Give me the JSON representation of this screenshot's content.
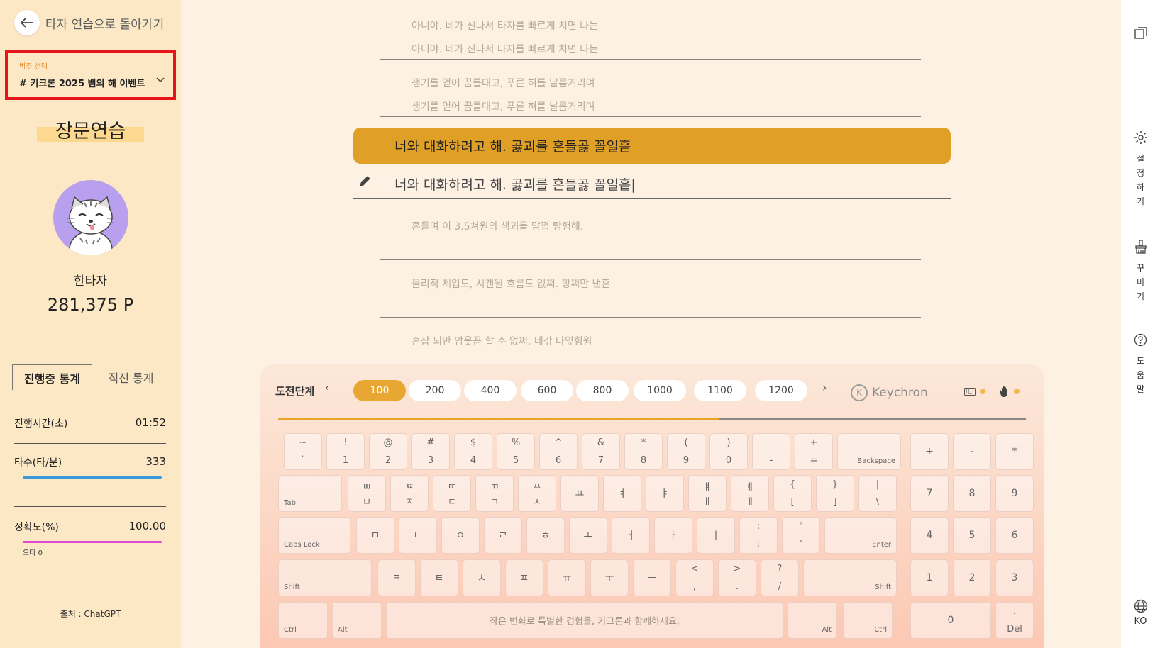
{
  "sidebar": {
    "back_label": "타자 연습으로 돌아가기",
    "category_label": "범주 선택",
    "category_value": "# 키크론 2025 뱀의 해 이벤트",
    "mode_title": "장문연습",
    "username": "한타자",
    "points": "281,375 P",
    "tabs": [
      "진행중 통계",
      "직전 통계"
    ],
    "stats": {
      "time_label": "진행시간(초)",
      "time_value": "01:52",
      "speed_label": "타수(타/분)",
      "speed_value": "333",
      "accuracy_label": "정확도(%)",
      "accuracy_value": "100.00",
      "typo_label": "오타 0"
    },
    "source": "출처 : ChatGPT",
    "colors": {
      "speed_bar": "#3a9ad9",
      "accuracy_bar": "#e24ad1"
    }
  },
  "passage": {
    "prev_lines": [
      {
        "text": "아니야. 네가 신나서 타자를 빠르게 치면 나는",
        "typed": "아니야. 네가 신나서 타자를 빠르게 치면 나는"
      },
      {
        "text": "생기를 얻어 꿈틀대고, 푸른 혀를 날름거리며",
        "typed": "생기를 얻어 꿈틀대고, 푸른 혀를 날름거리며"
      }
    ],
    "current_line": "너와 대화하려고 해. 곯괴를 흔들곯 꼴일흩",
    "current_input": "너와 대화하려고 해. 곯괴를 흔들곯 꼴일흩|",
    "next_lines": [
      "흔들며 이 3.5쳐원의 색괴를 맘껍 탐험해.",
      "물리적 제입도, 시갠윌 흐름도 없쩌. 항쩌만 낸흔",
      "혼잡 되만 암웃꼳 할 수 없쩌. 네갂 타잎힝윔"
    ]
  },
  "keyboard": {
    "challenge_label": "도전단계",
    "levels": [
      "100",
      "200",
      "400",
      "600",
      "800",
      "1000",
      "1100",
      "1200"
    ],
    "active_level": "100",
    "brand": "Keychron",
    "progress": 0.59,
    "space_text": "작은 변화로 특별한 경험을, 키크론과 함께하세요.",
    "row1": [
      [
        "~",
        "`"
      ],
      [
        "!",
        "1"
      ],
      [
        "@",
        "2"
      ],
      [
        "#",
        "3"
      ],
      [
        "$",
        "4"
      ],
      [
        "%",
        "5"
      ],
      [
        "^",
        "6"
      ],
      [
        "&",
        "7"
      ],
      [
        "*",
        "8"
      ],
      [
        "(",
        "9"
      ],
      [
        ")",
        "0"
      ],
      [
        "_",
        "-"
      ],
      [
        "+",
        "="
      ]
    ],
    "row1_backspace": "Backspace",
    "row2_tab": "Tab",
    "row2": [
      [
        "ㅃ",
        "ㅂ"
      ],
      [
        "ㅉ",
        "ㅈ"
      ],
      [
        "ㄸ",
        "ㄷ"
      ],
      [
        "ㄲ",
        "ㄱ"
      ],
      [
        "ㅆ",
        "ㅅ"
      ],
      [
        "",
        "ㅛ"
      ],
      [
        "",
        "ㅕ"
      ],
      [
        "",
        "ㅑ"
      ],
      [
        "ㅒ",
        "ㅐ"
      ],
      [
        "ㅖ",
        "ㅔ"
      ],
      [
        "{",
        "["
      ],
      [
        "}",
        "]"
      ],
      [
        "|",
        "\\"
      ]
    ],
    "row3_caps": "Caps Lock",
    "row3": [
      [
        "",
        "ㅁ"
      ],
      [
        "",
        "ㄴ"
      ],
      [
        "",
        "ㅇ"
      ],
      [
        "",
        "ㄹ"
      ],
      [
        "",
        "ㅎ"
      ],
      [
        "",
        "ㅗ"
      ],
      [
        "",
        "ㅓ"
      ],
      [
        "",
        "ㅏ"
      ],
      [
        "",
        "ㅣ"
      ],
      [
        ":",
        ";"
      ],
      [
        "\"",
        "'"
      ]
    ],
    "row3_enter": "Enter",
    "row4_shift": "Shift",
    "row4": [
      [
        "",
        "ㅋ"
      ],
      [
        "",
        "ㅌ"
      ],
      [
        "",
        "ㅊ"
      ],
      [
        "",
        "ㅍ"
      ],
      [
        "",
        "ㅠ"
      ],
      [
        "",
        "ㅜ"
      ],
      [
        "",
        "ㅡ"
      ],
      [
        "<",
        ","
      ],
      [
        ">",
        "."
      ],
      [
        "?",
        "/"
      ]
    ],
    "row5": [
      "Ctrl",
      "Alt",
      "Alt",
      "Ctrl"
    ],
    "numpad": [
      [
        "+",
        "-",
        "*"
      ],
      [
        "7",
        "8",
        "9"
      ],
      [
        "4",
        "5",
        "6"
      ],
      [
        "1",
        "2",
        "3"
      ],
      [
        "0",
        ".",
        "Del"
      ]
    ]
  },
  "right_bar": {
    "settings": "설정하기",
    "decorate": "꾸미기",
    "help": "도움말",
    "lang": "KO"
  }
}
